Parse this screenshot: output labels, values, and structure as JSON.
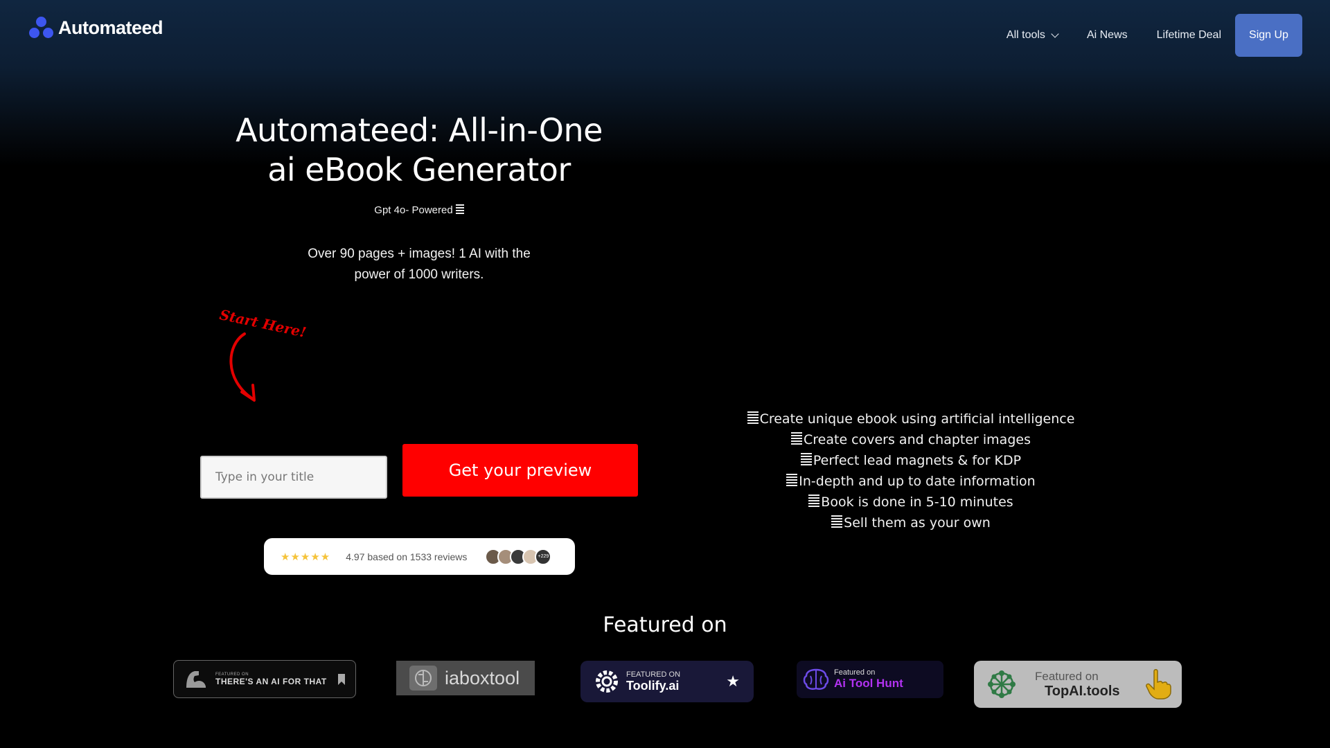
{
  "header": {
    "brand": "Automateed",
    "nav": {
      "all_tools": "All tools",
      "ai_news": "Ai News",
      "lifetime_deal": "Lifetime Deal",
      "sign_up": "Sign Up"
    }
  },
  "hero": {
    "title_line1": "Automateed: All-in-One",
    "title_line2": "ai eBook Generator",
    "subtitle": "Gpt 4o- Powered",
    "description_line1": "Over 90 pages + images! 1 AI with the",
    "description_line2": "power of 1000 writers.",
    "start_here": "Start Here!",
    "input_placeholder": "Type in your title",
    "cta_label": "Get your preview"
  },
  "reviews": {
    "stars": "★★★★★",
    "rating": 4.97,
    "text": "4.97 based on 1533 reviews",
    "more_count": "+229"
  },
  "features": [
    "Create unique ebook using artificial intelligence",
    "Create covers and chapter images",
    "Perfect lead magnets & for KDP",
    "In-depth and up to date information",
    "Book is done in 5-10 minutes",
    "Sell them as your own"
  ],
  "featured": {
    "title": "Featured on",
    "badges": {
      "aiforthat_small": "FEATURED ON",
      "aiforthat_big": "THERE'S AN AI FOR THAT",
      "iaboxtool": "iaboxtool",
      "toolify_small": "FEATURED ON",
      "toolify_big": "Toolify.ai",
      "aitoolhunt_small": "Featured on",
      "aitoolhunt_big": "Ai Tool Hunt",
      "topai_small": "Featured on",
      "topai_big": "TopAI.tools"
    }
  },
  "colors": {
    "cta": "#ff0000",
    "signup": "#4a6fc4",
    "brand_dots": "#3d56f0",
    "stars": "#f5c33b"
  }
}
